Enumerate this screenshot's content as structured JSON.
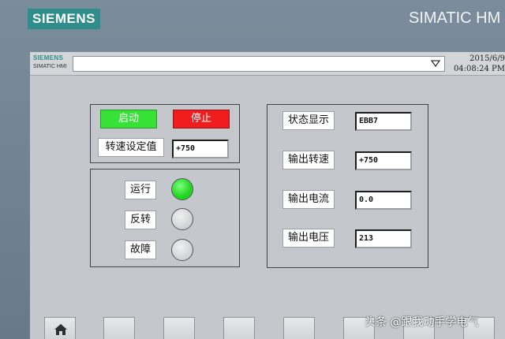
{
  "bezel": {
    "brand": "SIEMENS",
    "product": "SIMATIC HM"
  },
  "topbar": {
    "logo": "SIEMENS",
    "sub": "SIMATIC HMI",
    "screen_select_value": "",
    "date": "2015/6/9",
    "time": "04:08:24 PM"
  },
  "controls": {
    "start_label": "启动",
    "stop_label": "停止",
    "speed_setpoint_label": "转速设定值",
    "speed_setpoint_value": "+750"
  },
  "status_indicators": [
    {
      "label": "运行",
      "state": "on"
    },
    {
      "label": "反转",
      "state": "off"
    },
    {
      "label": "故障",
      "state": "off"
    }
  ],
  "readouts": [
    {
      "label": "状态显示",
      "value": "EBB7"
    },
    {
      "label": "输出转速",
      "value": "+750"
    },
    {
      "label": "输出电流",
      "value": "0.0"
    },
    {
      "label": "输出电压",
      "value": "213"
    }
  ],
  "watermark": "头条 @跟我动手学电气",
  "colors": {
    "start_green": "#36e236",
    "stop_red": "#ef1d1d",
    "lamp_on": "#1fd41f",
    "brand_teal": "#2f8e8c",
    "screen_bg": "#c4c8cc"
  },
  "icons": {
    "home_key": "home-icon",
    "dropdown": "chevron-down-icon"
  }
}
